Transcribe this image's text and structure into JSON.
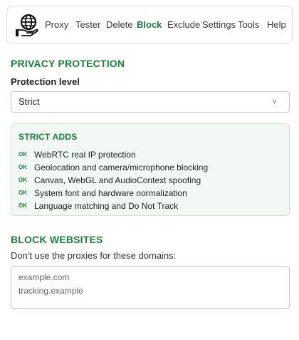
{
  "nav": {
    "logo_icon": "globe-hand-icon",
    "items": [
      "Proxy",
      "Tester",
      "Delete",
      "Block",
      "Exclude",
      "Settings",
      "Tools",
      "Help"
    ],
    "active": "Block"
  },
  "privacy": {
    "title": "PRIVACY PROTECTION",
    "level_label": "Protection level",
    "level_value": "Strict",
    "caret": "v"
  },
  "strict_adds": {
    "title": "STRICT ADDS",
    "badge": "OK",
    "items": [
      "WebRTC real IP protection",
      "Geolocation and camera/microphone blocking",
      "Canvas, WebGL and AudioContext spoofing",
      "System font and hardware normalization",
      "Language matching and Do Not Track"
    ]
  },
  "block": {
    "title": "BLOCK WEBSITES",
    "description": "Don't use the proxies for these domains:",
    "placeholder": "example.com\ntracking.example"
  },
  "colors": {
    "accent": "#1a7f3c",
    "box_bg": "#f2f8f3"
  }
}
